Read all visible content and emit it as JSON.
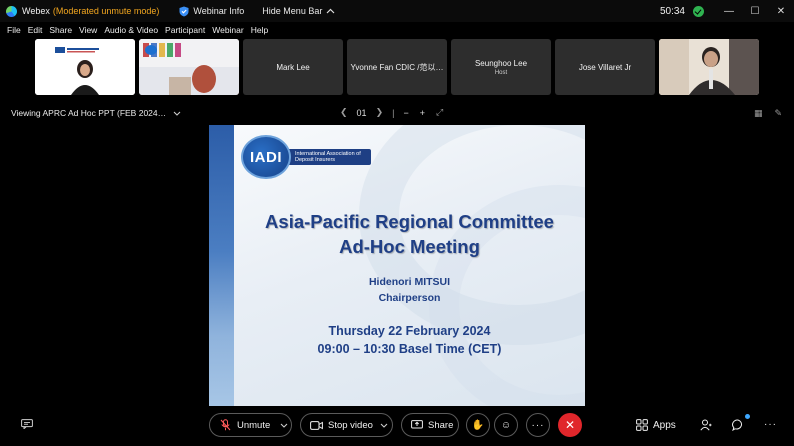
{
  "titlebar": {
    "app_name": "Webex",
    "mode": "(Moderated unmute mode)",
    "webinar_info": "Webinar Info",
    "hide_menu": "Hide Menu Bar",
    "time": "50:34",
    "minimize": "—",
    "maximize": "☐",
    "close": "✕"
  },
  "menu": [
    "File",
    "Edit",
    "Share",
    "View",
    "Audio & Video",
    "Participant",
    "Webinar",
    "Help"
  ],
  "participants": [
    {
      "name": "",
      "role": "",
      "kind": "video-white"
    },
    {
      "name": "",
      "role": "",
      "kind": "video-room"
    },
    {
      "name": "Mark Lee",
      "role": ""
    },
    {
      "name": "Yvonne Fan CDIC /范以…",
      "role": ""
    },
    {
      "name": "Seunghoo Lee",
      "role": "Host"
    },
    {
      "name": "Jose Villaret Jr",
      "role": ""
    },
    {
      "name": "",
      "role": "",
      "kind": "video-person"
    }
  ],
  "view": {
    "title": "Viewing APRC Ad Hoc PPT (FEB 2024…",
    "page": "01"
  },
  "slide": {
    "logo_text": "IADI",
    "logo_caption": "International Association of Deposit Insurers",
    "title_line1": "Asia-Pacific Regional Committee",
    "title_line2": "Ad-Hoc Meeting",
    "presenter": "Hidenori MITSUI",
    "presenter_role": "Chairperson",
    "date": "Thursday 22 February 2024",
    "time": "09:00 – 10:30  Basel Time (CET)"
  },
  "controls": {
    "unmute": "Unmute",
    "stop_video": "Stop video",
    "share": "Share",
    "apps": "Apps"
  },
  "colors": {
    "end_call": "#e0262b",
    "mode_text": "#f2a61f",
    "slide_title": "#1f3f86"
  }
}
